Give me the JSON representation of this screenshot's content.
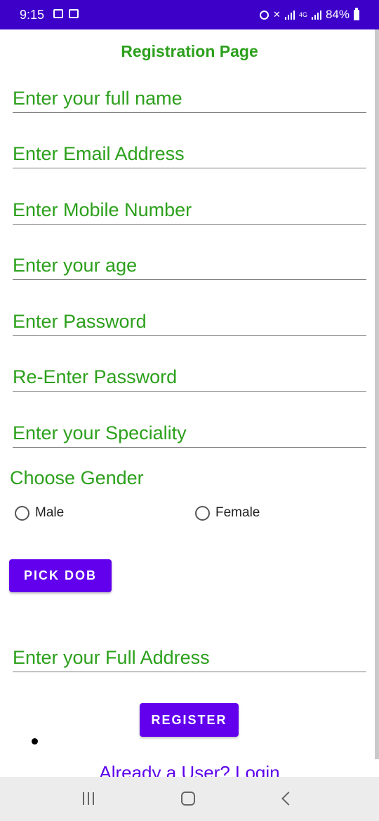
{
  "status_bar": {
    "time": "9:15",
    "network_type": "4G",
    "battery": "84%"
  },
  "page": {
    "title": "Registration Page"
  },
  "fields": {
    "full_name": {
      "placeholder": "Enter your full name",
      "value": ""
    },
    "email": {
      "placeholder": "Enter Email Address",
      "value": ""
    },
    "mobile": {
      "placeholder": "Enter Mobile Number",
      "value": ""
    },
    "age": {
      "placeholder": "Enter your age",
      "value": ""
    },
    "password": {
      "placeholder": "Enter Password",
      "value": ""
    },
    "reenter_password": {
      "placeholder": "Re-Enter Password",
      "value": ""
    },
    "speciality": {
      "placeholder": "Enter your Speciality",
      "value": ""
    },
    "address": {
      "placeholder": "Enter your Full Address",
      "value": ""
    }
  },
  "gender": {
    "label": "Choose Gender",
    "options": [
      "Male",
      "Female"
    ],
    "selected": null
  },
  "buttons": {
    "pick_dob": "PICK DOB",
    "register": "REGISTER"
  },
  "login_link": "Already a User? Login",
  "colors": {
    "accent_green": "#2ca01c",
    "button_purple": "#6200ee",
    "status_bar": "#3d00c9"
  }
}
